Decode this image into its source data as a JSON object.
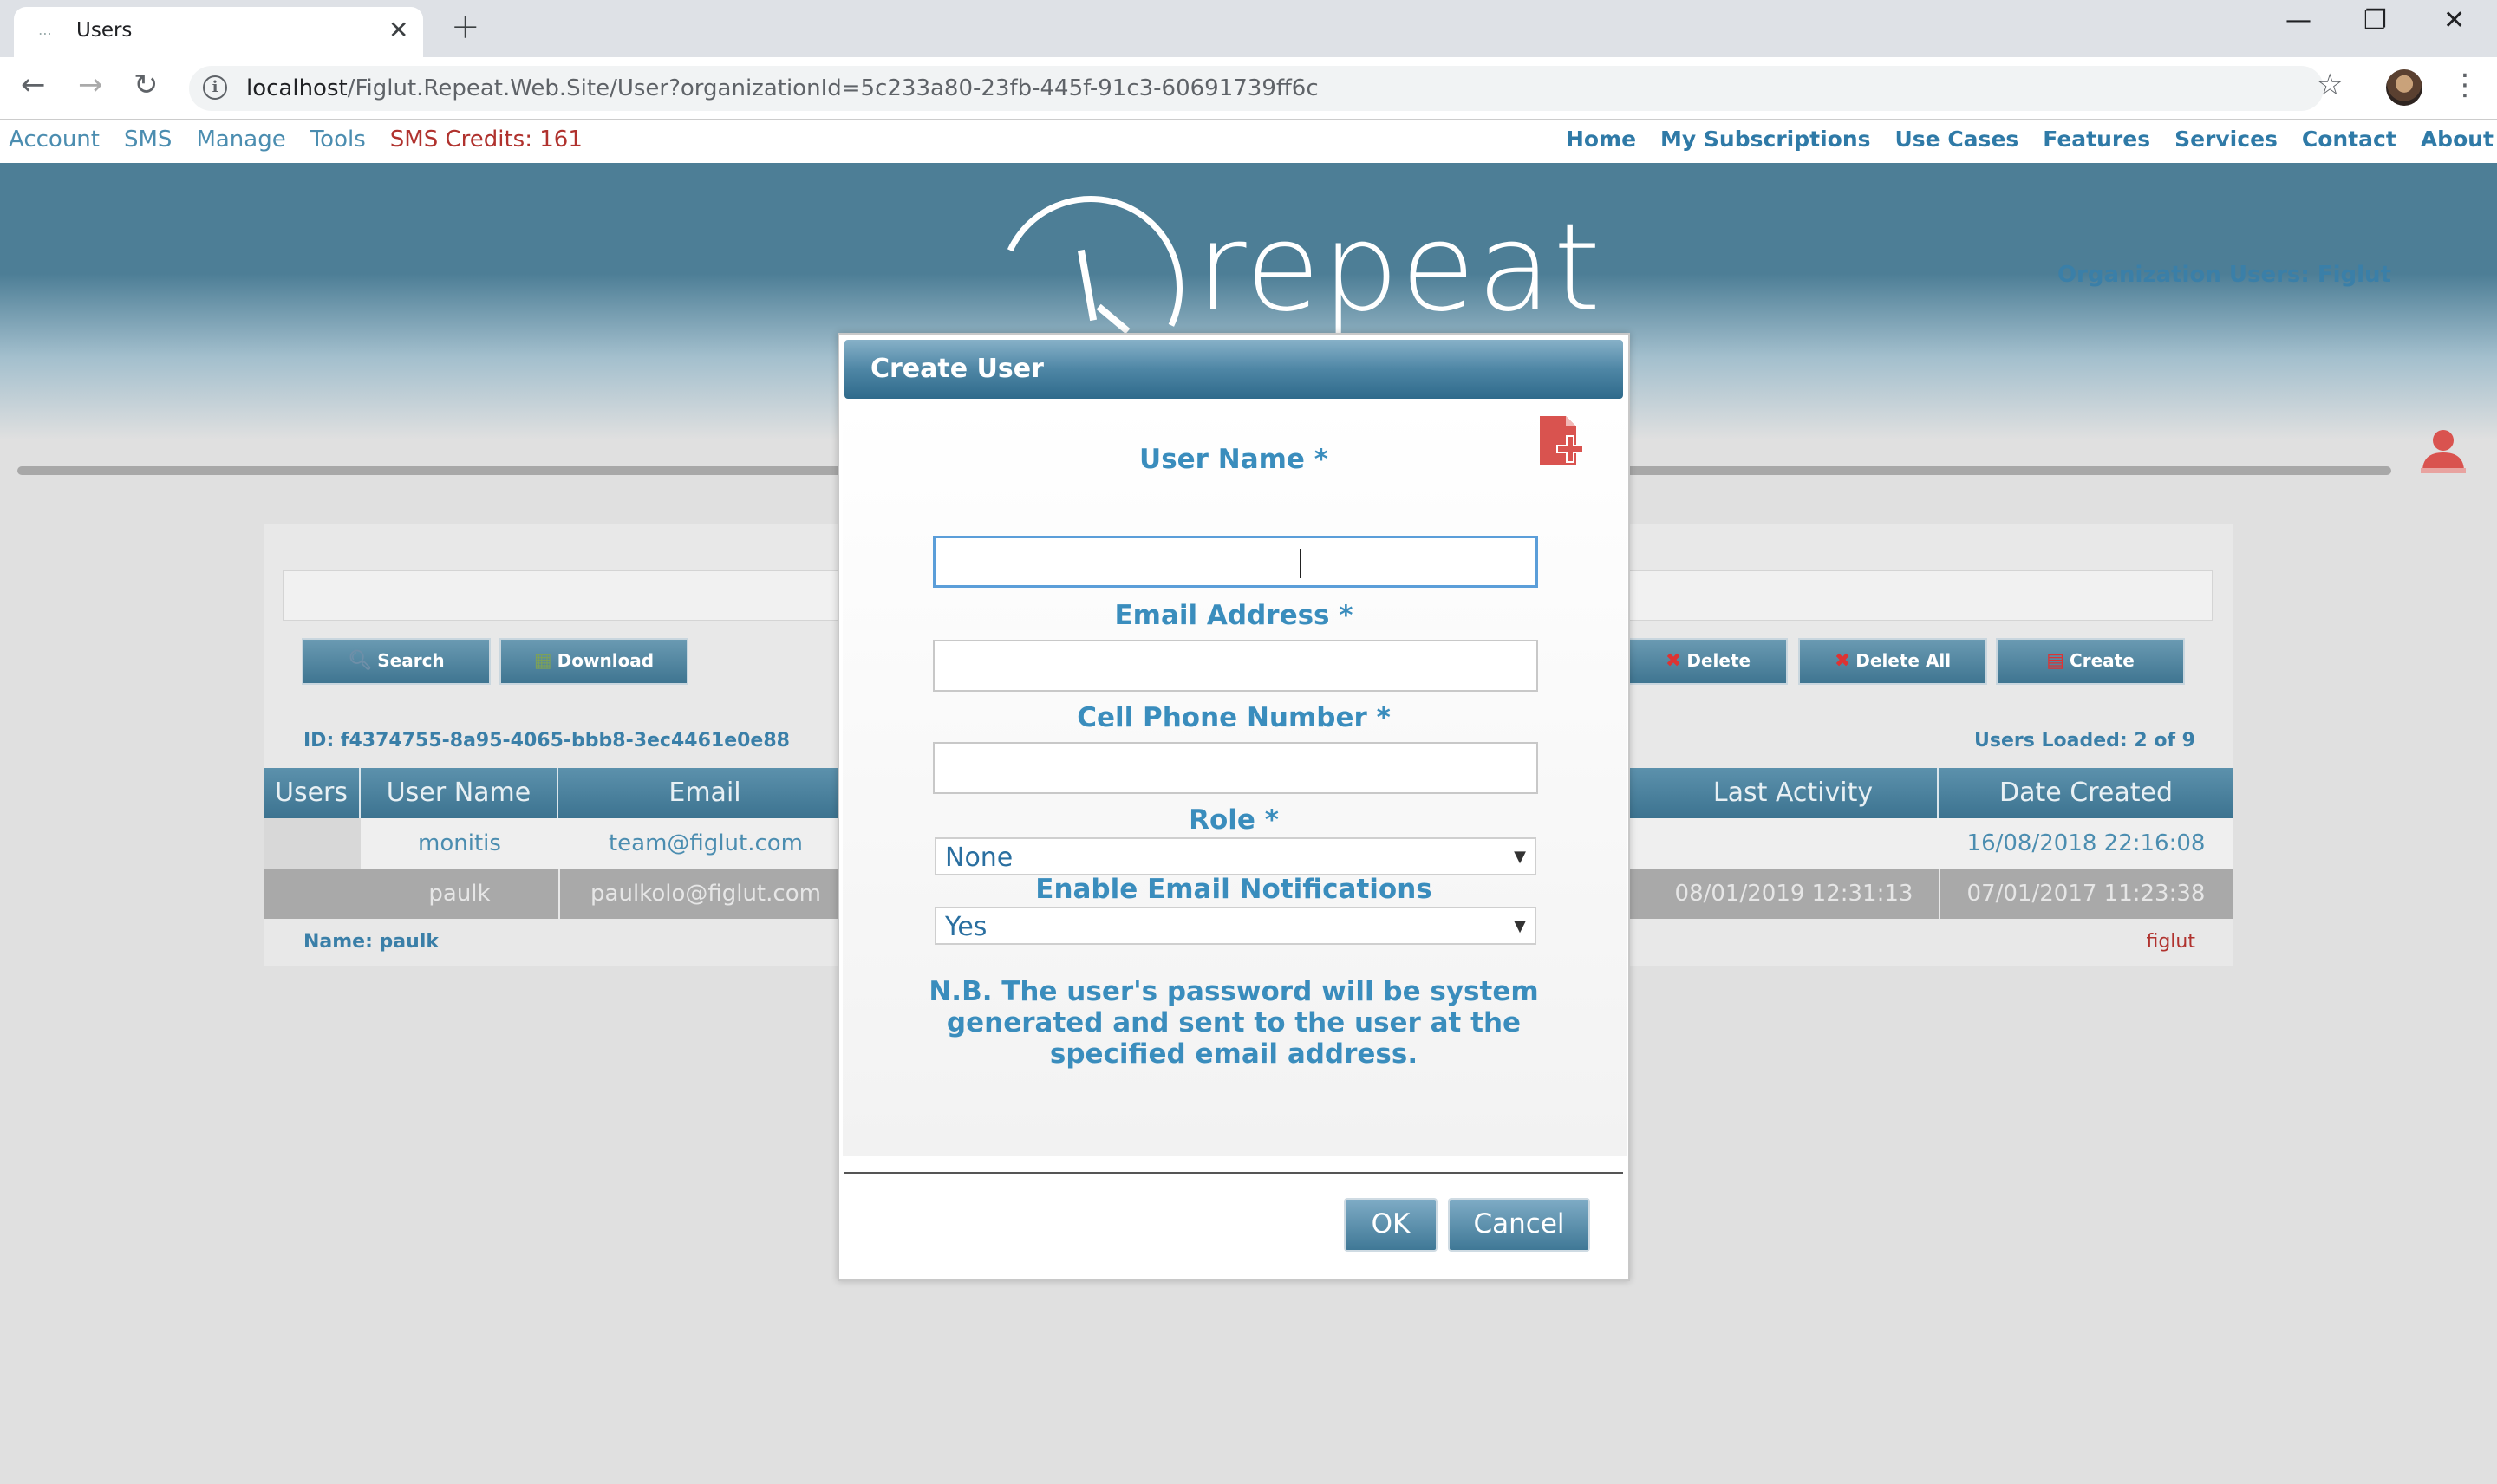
{
  "browser": {
    "tab_title": "Users",
    "url_host": "localhost",
    "url_path": "/Figlut.Repeat.Web.Site/User?organizationId=5c233a80-23fb-445f-91c3-60691739ff6c"
  },
  "site_menu": {
    "left": [
      "Account",
      "SMS",
      "Manage",
      "Tools"
    ],
    "credits": "SMS Credits: 161",
    "right": [
      "Home",
      "My Subscriptions",
      "Use Cases",
      "Features",
      "Services",
      "Contact",
      "About"
    ]
  },
  "header": {
    "logo_text": "repeat",
    "org_title": "Organization Users: Figlut"
  },
  "toolbar": {
    "search": "Search",
    "download": "Download",
    "delete": "Delete",
    "delete_all": "Delete All",
    "create": "Create"
  },
  "info": {
    "id_line": "ID: f4374755-8a95-4065-bbb8-3ec4461e0e88",
    "loaded": "Users Loaded: 2 of 9",
    "name_line": "Name: paulk",
    "org": "figlut"
  },
  "table": {
    "headers": {
      "users": "Users",
      "user_name": "User Name",
      "email": "Email",
      "last_activity": "Last Activity",
      "date_created": "Date Created"
    },
    "rows": [
      {
        "user_name": "monitis",
        "email": "team@figlut.com",
        "last_activity": "",
        "date_created": "16/08/2018 22:16:08"
      },
      {
        "user_name": "paulk",
        "email": "paulkolo@figlut.com",
        "last_activity": "08/01/2019 12:31:13",
        "date_created": "07/01/2017 11:23:38"
      }
    ]
  },
  "modal": {
    "title": "Create User",
    "user_name_label": "User Name *",
    "user_name_value": "",
    "email_label": "Email Address *",
    "email_value": "",
    "phone_label": "Cell Phone Number *",
    "phone_value": "",
    "role_label": "Role *",
    "role_value": "None",
    "notify_label": "Enable Email Notifications",
    "notify_value": "Yes",
    "note": "N.B. The user's password will be system generated and sent to the user at the specified email address.",
    "ok": "OK",
    "cancel": "Cancel"
  },
  "colors": {
    "accent": "#3a8dbd",
    "banner": "#4d7e96",
    "credits": "#b0322e"
  }
}
